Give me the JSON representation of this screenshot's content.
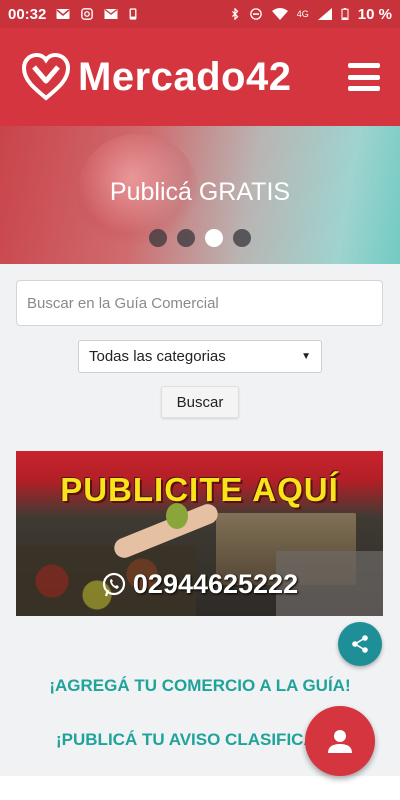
{
  "status_bar": {
    "time": "00:32",
    "network": "4G",
    "battery": "10 %",
    "icons": [
      "gmail-icon",
      "instagram-icon",
      "mail-icon",
      "phone-icon",
      "bluetooth-icon",
      "dnd-icon",
      "wifi-icon",
      "signal-icon",
      "battery-icon"
    ]
  },
  "header": {
    "logo_text": "Mercado42",
    "menu_icon": "hamburger-icon"
  },
  "hero": {
    "title": "Publicá GRATIS",
    "slides": 4,
    "active_slide": 3
  },
  "search": {
    "placeholder": "Buscar en la Guía Comercial",
    "value": "",
    "category_selected": "Todas las categorias",
    "button_label": "Buscar"
  },
  "banner": {
    "title": "PUBLICITE AQUÍ",
    "phone": "02944625222",
    "icon": "whatsapp-icon"
  },
  "links": {
    "add_business": "¡AGREGÁ TU COMERCIO A LA GUÍA!",
    "publish_ad": "¡PUBLICÁ TU AVISO CLASIFICADO!"
  },
  "fabs": {
    "share_icon": "share-icon",
    "user_icon": "user-icon"
  },
  "colors": {
    "brand_red": "#d5353e",
    "teal": "#1fa39a",
    "share_fab": "#1e8f96"
  }
}
